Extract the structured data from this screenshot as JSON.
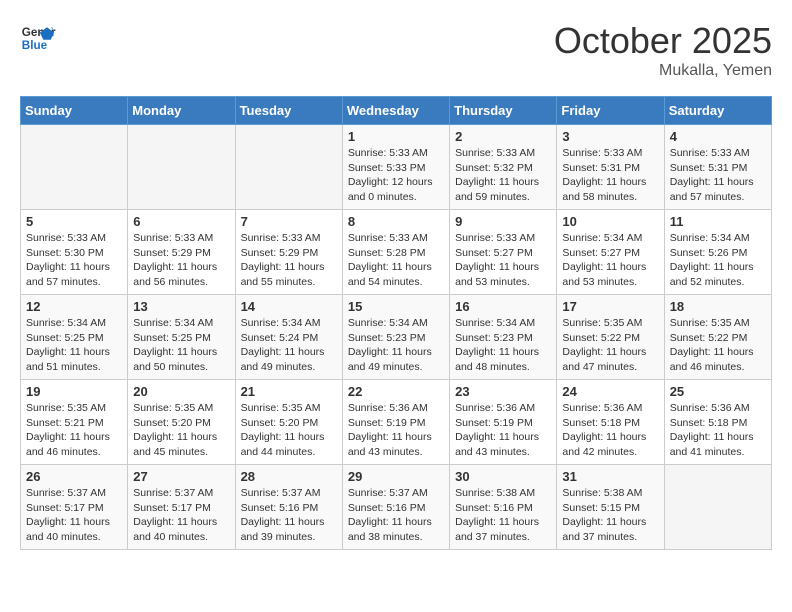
{
  "header": {
    "logo_general": "General",
    "logo_blue": "Blue",
    "month": "October 2025",
    "location": "Mukalla, Yemen"
  },
  "days_of_week": [
    "Sunday",
    "Monday",
    "Tuesday",
    "Wednesday",
    "Thursday",
    "Friday",
    "Saturday"
  ],
  "weeks": [
    [
      {
        "day": "",
        "info": ""
      },
      {
        "day": "",
        "info": ""
      },
      {
        "day": "",
        "info": ""
      },
      {
        "day": "1",
        "info": "Sunrise: 5:33 AM\nSunset: 5:33 PM\nDaylight: 12 hours\nand 0 minutes."
      },
      {
        "day": "2",
        "info": "Sunrise: 5:33 AM\nSunset: 5:32 PM\nDaylight: 11 hours\nand 59 minutes."
      },
      {
        "day": "3",
        "info": "Sunrise: 5:33 AM\nSunset: 5:31 PM\nDaylight: 11 hours\nand 58 minutes."
      },
      {
        "day": "4",
        "info": "Sunrise: 5:33 AM\nSunset: 5:31 PM\nDaylight: 11 hours\nand 57 minutes."
      }
    ],
    [
      {
        "day": "5",
        "info": "Sunrise: 5:33 AM\nSunset: 5:30 PM\nDaylight: 11 hours\nand 57 minutes."
      },
      {
        "day": "6",
        "info": "Sunrise: 5:33 AM\nSunset: 5:29 PM\nDaylight: 11 hours\nand 56 minutes."
      },
      {
        "day": "7",
        "info": "Sunrise: 5:33 AM\nSunset: 5:29 PM\nDaylight: 11 hours\nand 55 minutes."
      },
      {
        "day": "8",
        "info": "Sunrise: 5:33 AM\nSunset: 5:28 PM\nDaylight: 11 hours\nand 54 minutes."
      },
      {
        "day": "9",
        "info": "Sunrise: 5:33 AM\nSunset: 5:27 PM\nDaylight: 11 hours\nand 53 minutes."
      },
      {
        "day": "10",
        "info": "Sunrise: 5:34 AM\nSunset: 5:27 PM\nDaylight: 11 hours\nand 53 minutes."
      },
      {
        "day": "11",
        "info": "Sunrise: 5:34 AM\nSunset: 5:26 PM\nDaylight: 11 hours\nand 52 minutes."
      }
    ],
    [
      {
        "day": "12",
        "info": "Sunrise: 5:34 AM\nSunset: 5:25 PM\nDaylight: 11 hours\nand 51 minutes."
      },
      {
        "day": "13",
        "info": "Sunrise: 5:34 AM\nSunset: 5:25 PM\nDaylight: 11 hours\nand 50 minutes."
      },
      {
        "day": "14",
        "info": "Sunrise: 5:34 AM\nSunset: 5:24 PM\nDaylight: 11 hours\nand 49 minutes."
      },
      {
        "day": "15",
        "info": "Sunrise: 5:34 AM\nSunset: 5:23 PM\nDaylight: 11 hours\nand 49 minutes."
      },
      {
        "day": "16",
        "info": "Sunrise: 5:34 AM\nSunset: 5:23 PM\nDaylight: 11 hours\nand 48 minutes."
      },
      {
        "day": "17",
        "info": "Sunrise: 5:35 AM\nSunset: 5:22 PM\nDaylight: 11 hours\nand 47 minutes."
      },
      {
        "day": "18",
        "info": "Sunrise: 5:35 AM\nSunset: 5:22 PM\nDaylight: 11 hours\nand 46 minutes."
      }
    ],
    [
      {
        "day": "19",
        "info": "Sunrise: 5:35 AM\nSunset: 5:21 PM\nDaylight: 11 hours\nand 46 minutes."
      },
      {
        "day": "20",
        "info": "Sunrise: 5:35 AM\nSunset: 5:20 PM\nDaylight: 11 hours\nand 45 minutes."
      },
      {
        "day": "21",
        "info": "Sunrise: 5:35 AM\nSunset: 5:20 PM\nDaylight: 11 hours\nand 44 minutes."
      },
      {
        "day": "22",
        "info": "Sunrise: 5:36 AM\nSunset: 5:19 PM\nDaylight: 11 hours\nand 43 minutes."
      },
      {
        "day": "23",
        "info": "Sunrise: 5:36 AM\nSunset: 5:19 PM\nDaylight: 11 hours\nand 43 minutes."
      },
      {
        "day": "24",
        "info": "Sunrise: 5:36 AM\nSunset: 5:18 PM\nDaylight: 11 hours\nand 42 minutes."
      },
      {
        "day": "25",
        "info": "Sunrise: 5:36 AM\nSunset: 5:18 PM\nDaylight: 11 hours\nand 41 minutes."
      }
    ],
    [
      {
        "day": "26",
        "info": "Sunrise: 5:37 AM\nSunset: 5:17 PM\nDaylight: 11 hours\nand 40 minutes."
      },
      {
        "day": "27",
        "info": "Sunrise: 5:37 AM\nSunset: 5:17 PM\nDaylight: 11 hours\nand 40 minutes."
      },
      {
        "day": "28",
        "info": "Sunrise: 5:37 AM\nSunset: 5:16 PM\nDaylight: 11 hours\nand 39 minutes."
      },
      {
        "day": "29",
        "info": "Sunrise: 5:37 AM\nSunset: 5:16 PM\nDaylight: 11 hours\nand 38 minutes."
      },
      {
        "day": "30",
        "info": "Sunrise: 5:38 AM\nSunset: 5:16 PM\nDaylight: 11 hours\nand 37 minutes."
      },
      {
        "day": "31",
        "info": "Sunrise: 5:38 AM\nSunset: 5:15 PM\nDaylight: 11 hours\nand 37 minutes."
      },
      {
        "day": "",
        "info": ""
      }
    ]
  ]
}
